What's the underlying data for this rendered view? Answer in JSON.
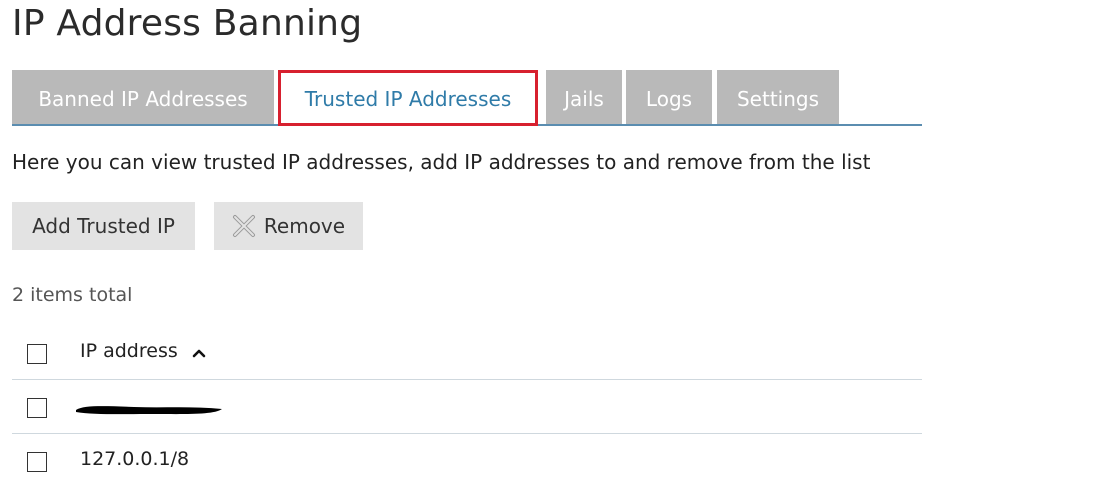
{
  "page": {
    "title": "IP Address Banning",
    "description": "Here you can view trusted IP addresses, add IP addresses to and remove from the list"
  },
  "tabs": [
    {
      "label": "Banned IP Addresses",
      "active": false
    },
    {
      "label": "Trusted IP Addresses",
      "active": true
    },
    {
      "label": "Jails",
      "active": false
    },
    {
      "label": "Logs",
      "active": false
    },
    {
      "label": "Settings",
      "active": false
    }
  ],
  "toolbar": {
    "add_label": "Add Trusted IP",
    "remove_label": "Remove",
    "remove_icon": "close-x-icon"
  },
  "list": {
    "items_total": "2 items total",
    "column_header": "IP address",
    "sort": "ascending",
    "rows": [
      {
        "ip": "",
        "redacted": true
      },
      {
        "ip": "127.0.0.1/8",
        "redacted": false
      }
    ]
  },
  "colors": {
    "tab_inactive_bg": "#b9b9b9",
    "tab_active_text": "#2f7ba8",
    "highlight_border": "#d7202f",
    "tab_underline": "#5b8db0",
    "button_bg": "#e3e3e3"
  }
}
